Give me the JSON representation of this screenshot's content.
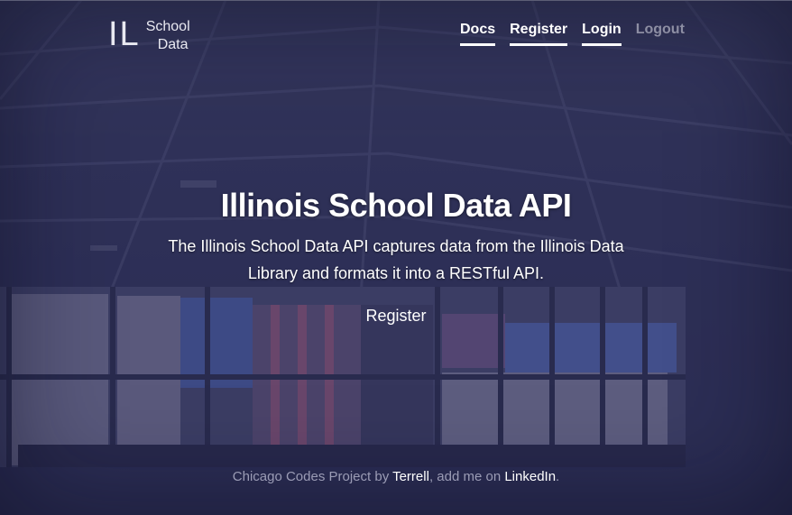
{
  "brand": {
    "mark": "IL",
    "line1": "School",
    "line2": "Data"
  },
  "nav": {
    "docs": "Docs",
    "register": "Register",
    "login": "Login",
    "logout": "Logout"
  },
  "hero": {
    "title": "Illinois School Data API",
    "description": "The Illinois School Data API captures data from the Illinois Data Library and formats it into a RESTful API.",
    "cta": "Register"
  },
  "footer": {
    "prefix": "Chicago Codes Project by ",
    "author": "Terrell",
    "middle": ", add me on ",
    "linkedin": "LinkedIn",
    "suffix": "."
  },
  "colors": {
    "accent": "#ffffff",
    "muted": "#8d8ea3",
    "overlay": "#30325f"
  }
}
